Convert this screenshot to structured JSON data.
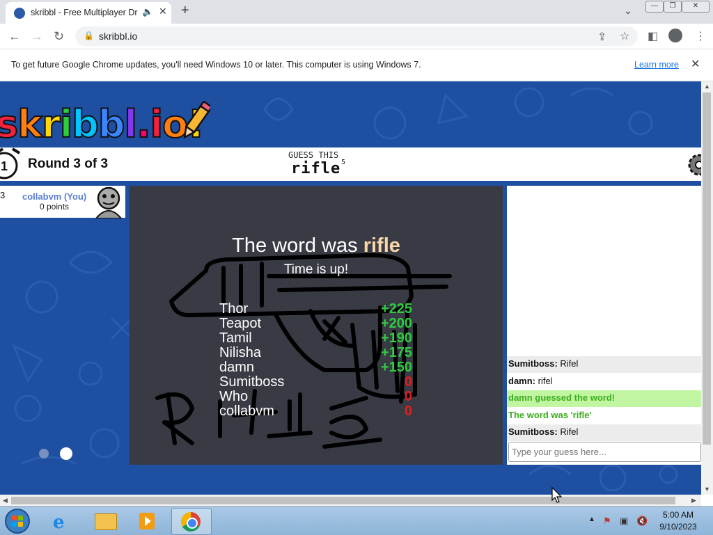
{
  "browser": {
    "tab_title": "skribbl - Free Multiplayer Dr",
    "url": "skribbl.io",
    "window_buttons": {
      "minimize": "—",
      "restore": "❐",
      "close": "✕"
    }
  },
  "infobar": {
    "message": "To get future Google Chrome updates, you'll need Windows 10 or later. This computer is using Windows 7.",
    "link": "Learn more"
  },
  "game": {
    "logo": [
      "s",
      "k",
      "r",
      "i",
      "b",
      "b",
      "l",
      ".",
      "i",
      "o",
      "!"
    ],
    "logo_colors": [
      "#ef233c",
      "#ff7f11",
      "#ffd60a",
      "#2ecc40",
      "#00c3ff",
      "#3a86ff",
      "#8338ec",
      "#ff006e",
      "#ef233c",
      "#ff7f11",
      "#ffd60a"
    ],
    "timer": "1",
    "round": "Round 3 of 3",
    "guess_label": "GUESS THIS",
    "hint_word": "rifle",
    "hint_count": "5",
    "player": {
      "rank": "3",
      "name": "collabvm (You)",
      "points": "0 points"
    },
    "reveal": {
      "prefix": "The word was ",
      "word": "rifle",
      "subtitle": "Time is up!"
    },
    "scores": [
      {
        "name": "Thor",
        "points": "+225",
        "color": "#2ecc40"
      },
      {
        "name": "Teapot",
        "points": "+200",
        "color": "#2ecc40"
      },
      {
        "name": "Tamil",
        "points": "+190",
        "color": "#2ecc40"
      },
      {
        "name": "Nilisha",
        "points": "+175",
        "color": "#2ecc40"
      },
      {
        "name": "damn",
        "points": "+150",
        "color": "#2ecc40"
      },
      {
        "name": "Sumitboss",
        "points": "0",
        "color": "#e02020"
      },
      {
        "name": "Who",
        "points": "0",
        "color": "#e02020"
      },
      {
        "name": "collabvm",
        "points": "0",
        "color": "#e02020"
      }
    ],
    "chat": [
      {
        "author": "Sumitboss:",
        "text": "Rifel",
        "bg": "#ececec",
        "color": "#111"
      },
      {
        "author": "damn:",
        "text": "rifel",
        "bg": "#ffffff",
        "color": "#111"
      },
      {
        "author": "",
        "text": "damn guessed the word!",
        "bg": "#c2f5a2",
        "color": "#3aae1d"
      },
      {
        "author": "",
        "text": "The word was 'rifle'",
        "bg": "#ffffff",
        "color": "#3aae1d"
      },
      {
        "author": "Sumitboss:",
        "text": "Rifel",
        "bg": "#ececec",
        "color": "#111"
      }
    ],
    "guess_placeholder": "Type your guess here..."
  },
  "taskbar": {
    "time": "5:00 AM",
    "date": "9/10/2023"
  }
}
